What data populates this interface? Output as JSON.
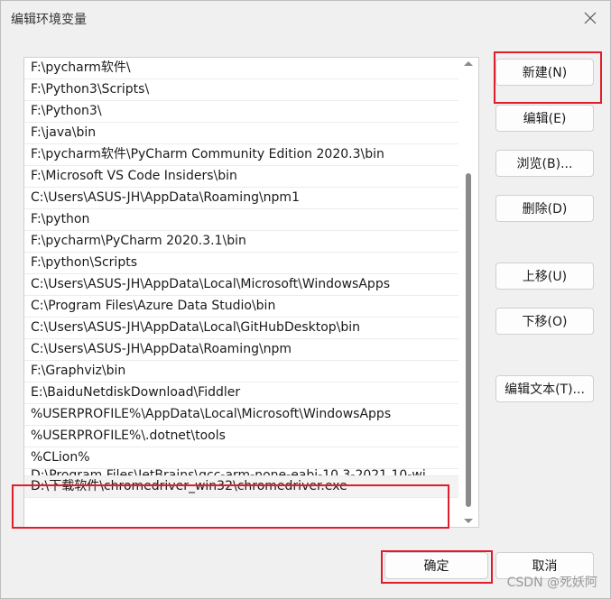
{
  "dialog": {
    "title": "编辑环境变量",
    "close_icon": "close-icon"
  },
  "env_list": {
    "items": [
      "F:\\pycharm软件\\",
      "F:\\Python3\\Scripts\\",
      "F:\\Python3\\",
      "F:\\java\\bin",
      "F:\\pycharm软件\\PyCharm Community Edition 2020.3\\bin",
      "F:\\Microsoft VS Code Insiders\\bin",
      "C:\\Users\\ASUS-JH\\AppData\\Roaming\\npm1",
      "F:\\python",
      "F:\\pycharm\\PyCharm 2020.3.1\\bin",
      "F:\\python\\Scripts",
      "C:\\Users\\ASUS-JH\\AppData\\Local\\Microsoft\\WindowsApps",
      "C:\\Program Files\\Azure Data Studio\\bin",
      "C:\\Users\\ASUS-JH\\AppData\\Local\\GitHubDesktop\\bin",
      "C:\\Users\\ASUS-JH\\AppData\\Roaming\\npm",
      "F:\\Graphviz\\bin",
      "E:\\BaiduNetdiskDownload\\Fiddler",
      "%USERPROFILE%\\AppData\\Local\\Microsoft\\WindowsApps",
      "%USERPROFILE%\\.dotnet\\tools",
      "%CLion%",
      "D:\\Program Files\\JetBrains\\gcc-arm-none-eabi-10.3-2021.10-wi...",
      "D:\\下载软件\\chromedriver_win32\\chromedriver.exe"
    ],
    "selected_index": 20
  },
  "buttons": {
    "new": "新建(N)",
    "edit": "编辑(E)",
    "browse": "浏览(B)...",
    "delete": "删除(D)",
    "move_up": "上移(U)",
    "move_down": "下移(O)",
    "edit_text": "编辑文本(T)...",
    "ok": "确定",
    "cancel": "取消"
  },
  "watermark": "CSDN @死妖阿",
  "colors": {
    "highlight": "#e01e2b",
    "background": "#f0f0f0"
  }
}
